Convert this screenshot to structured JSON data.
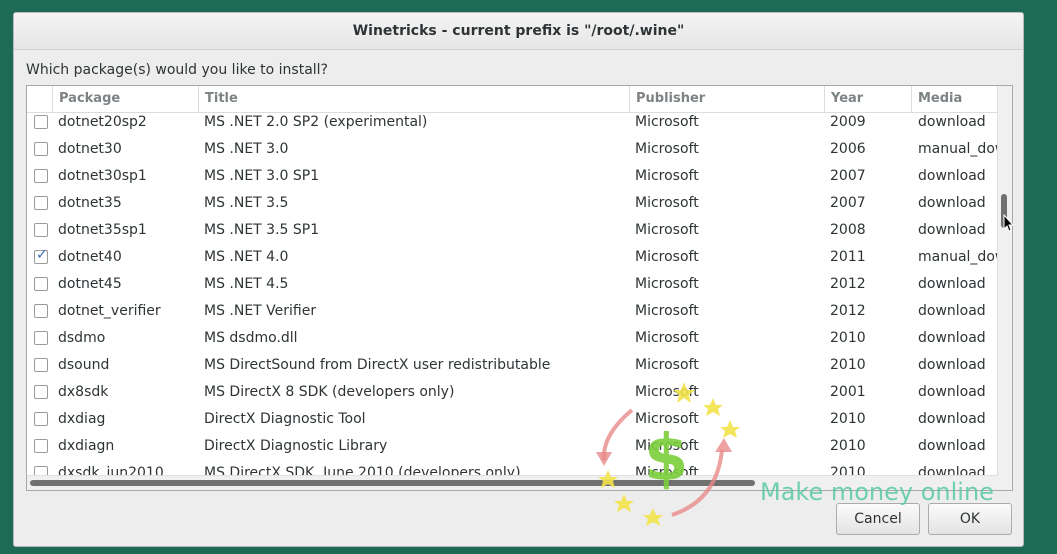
{
  "window": {
    "title": "Winetricks - current prefix is \"/root/.wine\""
  },
  "prompt": "Which package(s) would you like to install?",
  "columns": [
    "Package",
    "Title",
    "Publisher",
    "Year",
    "Media"
  ],
  "rows": [
    {
      "checked": false,
      "package": "dotnet20sp2",
      "title": "MS .NET 2.0 SP2 (experimental)",
      "publisher": "Microsoft",
      "year": "2009",
      "media": "download"
    },
    {
      "checked": false,
      "package": "dotnet30",
      "title": "MS .NET 3.0",
      "publisher": "Microsoft",
      "year": "2006",
      "media": "manual_download"
    },
    {
      "checked": false,
      "package": "dotnet30sp1",
      "title": "MS .NET 3.0 SP1",
      "publisher": "Microsoft",
      "year": "2007",
      "media": "download"
    },
    {
      "checked": false,
      "package": "dotnet35",
      "title": "MS .NET 3.5",
      "publisher": "Microsoft",
      "year": "2007",
      "media": "download"
    },
    {
      "checked": false,
      "package": "dotnet35sp1",
      "title": "MS .NET 3.5 SP1",
      "publisher": "Microsoft",
      "year": "2008",
      "media": "download"
    },
    {
      "checked": true,
      "package": "dotnet40",
      "title": "MS .NET 4.0",
      "publisher": "Microsoft",
      "year": "2011",
      "media": "manual_download"
    },
    {
      "checked": false,
      "package": "dotnet45",
      "title": "MS .NET 4.5",
      "publisher": "Microsoft",
      "year": "2012",
      "media": "download"
    },
    {
      "checked": false,
      "package": "dotnet_verifier",
      "title": "MS .NET Verifier",
      "publisher": "Microsoft",
      "year": "2012",
      "media": "download"
    },
    {
      "checked": false,
      "package": "dsdmo",
      "title": "MS dsdmo.dll",
      "publisher": "Microsoft",
      "year": "2010",
      "media": "download"
    },
    {
      "checked": false,
      "package": "dsound",
      "title": "MS DirectSound from DirectX user redistributable",
      "publisher": "Microsoft",
      "year": "2010",
      "media": "download"
    },
    {
      "checked": false,
      "package": "dx8sdk",
      "title": "MS DirectX 8 SDK (developers only)",
      "publisher": "Microsoft",
      "year": "2001",
      "media": "download"
    },
    {
      "checked": false,
      "package": "dxdiag",
      "title": "DirectX Diagnostic Tool",
      "publisher": "Microsoft",
      "year": "2010",
      "media": "download"
    },
    {
      "checked": false,
      "package": "dxdiagn",
      "title": "DirectX Diagnostic Library",
      "publisher": "Microsoft",
      "year": "2010",
      "media": "download"
    },
    {
      "checked": false,
      "package": "dxsdk_jun2010",
      "title": "MS DirectX SDK, June 2010 (developers only)",
      "publisher": "Microsoft",
      "year": "2010",
      "media": "download"
    }
  ],
  "buttons": {
    "cancel": "Cancel",
    "ok": "OK"
  },
  "watermark": {
    "text": "Make money online"
  },
  "colors": {
    "check": "#3b6db5",
    "desktop": "#1d6a55",
    "watermark": "#59c9a5"
  }
}
